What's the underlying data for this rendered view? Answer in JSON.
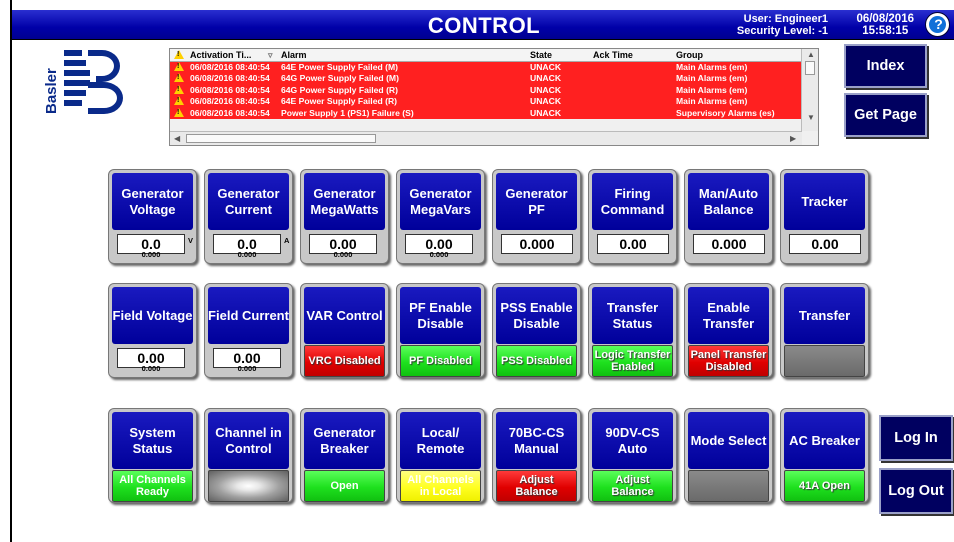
{
  "window": {
    "title": "CONTROL",
    "user_line": "User: Engineer1",
    "security_line": "Security Level: -1",
    "date": "06/08/2016",
    "time": "15:58:15",
    "help_label": "?"
  },
  "logo": {
    "text": "Basler",
    "icon": "basler-logo"
  },
  "alarm_table": {
    "columns": [
      "Activation Ti...",
      "Alarm",
      "State",
      "Ack Time",
      "Group"
    ],
    "rows": [
      {
        "time": "06/08/2016 08:40:54",
        "alarm": "64E Power Supply Failed (M)",
        "state": "UNACK",
        "ack": "",
        "group": "Main Alarms (em)"
      },
      {
        "time": "06/08/2016 08:40:54",
        "alarm": "64G Power Supply Failed (M)",
        "state": "UNACK",
        "ack": "",
        "group": "Main Alarms (em)"
      },
      {
        "time": "06/08/2016 08:40:54",
        "alarm": "64G Power Supply Failed (R)",
        "state": "UNACK",
        "ack": "",
        "group": "Main Alarms (em)"
      },
      {
        "time": "06/08/2016 08:40:54",
        "alarm": "64E Power Supply Failed (R)",
        "state": "UNACK",
        "ack": "",
        "group": "Main Alarms (em)"
      },
      {
        "time": "06/08/2016 08:40:54",
        "alarm": "Power Supply 1 (PS1) Failure (S)",
        "state": "UNACK",
        "ack": "",
        "group": "Supervisory Alarms (es)"
      }
    ],
    "row_color": "#ff2020"
  },
  "nav": {
    "index_label": "Index",
    "get_page_label": "Get Page",
    "log_in_label": "Log In",
    "log_out_label": "Log Out"
  },
  "tiles_row1": [
    {
      "name": "generator-voltage",
      "title": "Generator Voltage",
      "value": "0.0",
      "sub": "0.000",
      "unit": "V"
    },
    {
      "name": "generator-current",
      "title": "Generator Current",
      "value": "0.0",
      "sub": "0.000",
      "unit": "A"
    },
    {
      "name": "generator-megawatts",
      "title": "Generator MegaWatts",
      "value": "0.00",
      "sub": "0.000",
      "unit": ""
    },
    {
      "name": "generator-megavars",
      "title": "Generator MegaVars",
      "value": "0.00",
      "sub": "0.000",
      "unit": ""
    },
    {
      "name": "generator-pf",
      "title": "Generator PF",
      "value": "0.000",
      "sub": "",
      "unit": ""
    },
    {
      "name": "firing-command",
      "title": "Firing Command",
      "value": "0.00",
      "sub": "",
      "unit": ""
    },
    {
      "name": "man-auto-balance",
      "title": "Man/Auto Balance",
      "value": "0.000",
      "sub": "",
      "unit": ""
    },
    {
      "name": "tracker",
      "title": "Tracker",
      "value": "0.00",
      "sub": "",
      "unit": ""
    }
  ],
  "tiles_row2": [
    {
      "name": "field-voltage",
      "title": "Field Voltage",
      "value": "0.00",
      "sub": "0.000"
    },
    {
      "name": "field-current",
      "title": "Field Current",
      "value": "0.00",
      "sub": "0.000"
    },
    {
      "name": "var-control",
      "title": "VAR Control",
      "status": "VRC Disabled",
      "color": "red"
    },
    {
      "name": "pf-enable-disable",
      "title": "PF Enable Disable",
      "status": "PF Disabled",
      "color": "green"
    },
    {
      "name": "pss-enable-disable",
      "title": "PSS Enable Disable",
      "status": "PSS Disabled",
      "color": "green"
    },
    {
      "name": "transfer-status",
      "title": "Transfer Status",
      "status": "Logic Transfer Enabled",
      "color": "green"
    },
    {
      "name": "enable-transfer",
      "title": "Enable Transfer",
      "status": "Panel Transfer Disabled",
      "color": "red"
    },
    {
      "name": "transfer",
      "title": "Transfer",
      "status": "",
      "color": "grey"
    }
  ],
  "tiles_row3": [
    {
      "name": "system-status",
      "title": "System Status",
      "status": "All Channels Ready",
      "color": "green-dark"
    },
    {
      "name": "channel-in-control",
      "title": "Channel in Control",
      "status": "",
      "color": "glow"
    },
    {
      "name": "generator-breaker",
      "title": "Generator Breaker",
      "status": "Open",
      "color": "green-dark"
    },
    {
      "name": "local-remote",
      "title": "Local/ Remote",
      "status": "All Channels in Local",
      "color": "yellow"
    },
    {
      "name": "70bc-cs-manual",
      "title": "70BC-CS Manual",
      "status": "Adjust Balance",
      "color": "red"
    },
    {
      "name": "90dv-cs-auto",
      "title": "90DV-CS Auto",
      "status": "Adjust Balance",
      "color": "green"
    },
    {
      "name": "mode-select",
      "title": "Mode Select",
      "status": "",
      "color": "grey"
    },
    {
      "name": "ac-breaker",
      "title": "AC Breaker",
      "status": "41A Open",
      "color": "green"
    }
  ]
}
